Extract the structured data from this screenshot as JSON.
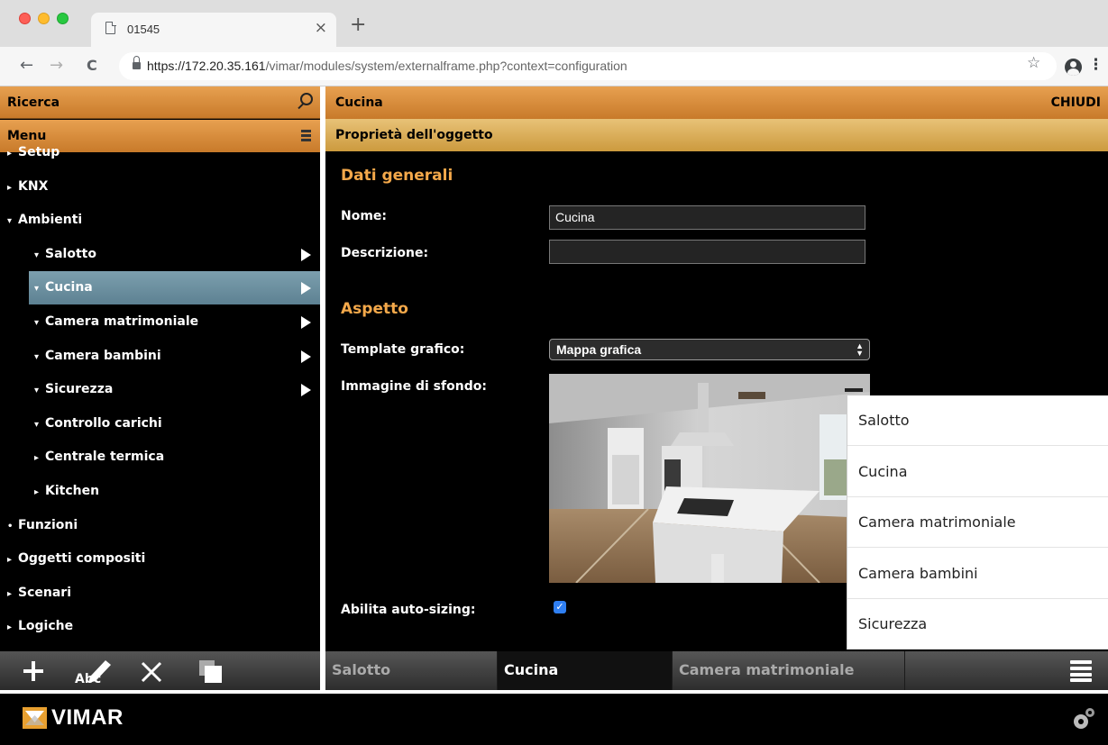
{
  "browser": {
    "tab_title": "01545",
    "tab_close": "×",
    "new_tab": "+",
    "back": "←",
    "forward": "→",
    "reload": "C",
    "url_host": "https://172.20.35.161",
    "url_path": "/vimar/modules/system/externalframe.php?context=configuration",
    "bookmark": "☆",
    "menu": "⋮"
  },
  "sidebar": {
    "search_label": "Ricerca",
    "menu_label": "Menu",
    "tree": [
      {
        "label": "Setup",
        "arrow": "▸",
        "level": 0
      },
      {
        "label": "KNX",
        "arrow": "▸",
        "level": 0
      },
      {
        "label": "Ambienti",
        "arrow": "▾",
        "level": 0
      },
      {
        "label": "Salotto",
        "arrow": "▾",
        "level": 1,
        "play": true
      },
      {
        "label": "Cucina",
        "arrow": "▾",
        "level": 1,
        "play": true,
        "selected": true
      },
      {
        "label": "Camera matrimoniale",
        "arrow": "▾",
        "level": 1,
        "play": true
      },
      {
        "label": "Camera bambini",
        "arrow": "▾",
        "level": 1,
        "play": true
      },
      {
        "label": "Sicurezza",
        "arrow": "▾",
        "level": 1,
        "play": true
      },
      {
        "label": "Controllo carichi",
        "arrow": "▾",
        "level": 1
      },
      {
        "label": "Centrale termica",
        "arrow": "▸",
        "level": 1
      },
      {
        "label": "Kitchen",
        "arrow": "▸",
        "level": 1
      },
      {
        "label": "Funzioni",
        "arrow": "•",
        "level": 0
      },
      {
        "label": "Oggetti compositi",
        "arrow": "▸",
        "level": 0
      },
      {
        "label": "Scenari",
        "arrow": "▸",
        "level": 0
      },
      {
        "label": "Logiche",
        "arrow": "▸",
        "level": 0
      }
    ],
    "toolbar": {
      "rename_text": "Abc"
    }
  },
  "main": {
    "title": "Cucina",
    "close_label": "CHIUDI",
    "subtitle": "Proprietà dell'oggetto",
    "general_section": "Dati generali",
    "name_label": "Nome:",
    "name_value": "Cucina",
    "description_label": "Descrizione:",
    "description_value": "",
    "appearance_section": "Aspetto",
    "template_label": "Template grafico:",
    "template_value": "Mappa grafica",
    "background_label": "Immagine di sfondo:",
    "autosize_label": "Abilita auto-sizing:",
    "autosize_checked": true
  },
  "dropdown": {
    "items": [
      "Salotto",
      "Cucina",
      "Camera matrimoniale",
      "Camera bambini",
      "Sicurezza"
    ]
  },
  "room_tabs": {
    "items": [
      "Salotto",
      "Cucina",
      "Camera matrimoniale"
    ],
    "active": "Cucina"
  },
  "footer": {
    "brand": "VIMAR"
  },
  "colors": {
    "header_orange": "#d98a3a",
    "subheader_gold": "#d9ad57",
    "section_title": "#f3a84a",
    "selected_item": "#6b8e9f",
    "checkbox_blue": "#2f7ff2"
  }
}
